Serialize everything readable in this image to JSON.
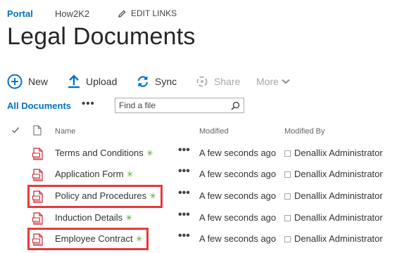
{
  "topnav": {
    "portal": "Portal",
    "site": "How2K2",
    "edit_links": "EDIT LINKS"
  },
  "page_title": "Legal Documents",
  "commands": {
    "new": "New",
    "upload": "Upload",
    "sync": "Sync",
    "share": "Share",
    "more": "More"
  },
  "views": {
    "all_documents": "All Documents",
    "ellipsis": "•••"
  },
  "search": {
    "placeholder": "Find a file"
  },
  "columns": {
    "name": "Name",
    "modified": "Modified",
    "modified_by": "Modified By"
  },
  "files": [
    {
      "name": "Terms and Conditions",
      "modified": "A few seconds ago",
      "modified_by": "Denallix Administrator",
      "new_marker": "✳",
      "highlighted": false
    },
    {
      "name": "Application Form",
      "modified": "A few seconds ago",
      "modified_by": "Denallix Administrator",
      "new_marker": "✳",
      "highlighted": false
    },
    {
      "name": "Policy and Procedures",
      "modified": "A few seconds ago",
      "modified_by": "Denallix Administrator",
      "new_marker": "✳",
      "highlighted": true
    },
    {
      "name": "Induction Details",
      "modified": "A few seconds ago",
      "modified_by": "Denallix Administrator",
      "new_marker": "✳",
      "highlighted": false
    },
    {
      "name": "Employee Contract",
      "modified": "A few seconds ago",
      "modified_by": "Denallix Administrator",
      "new_marker": "✳",
      "highlighted": true
    }
  ],
  "row_ellipsis": "•••",
  "colors": {
    "accent": "#0072c6",
    "highlight": "#e8393b",
    "new_marker": "#59a829",
    "pdf_red": "#c8232c"
  },
  "icons": {
    "new": "plus-circle-icon",
    "upload": "upload-arrow-icon",
    "sync": "sync-icon",
    "share": "share-icon",
    "more": "chevron-down-icon",
    "search": "magnifier-icon",
    "edit": "pencil-icon",
    "file": "pdf-file-icon"
  }
}
